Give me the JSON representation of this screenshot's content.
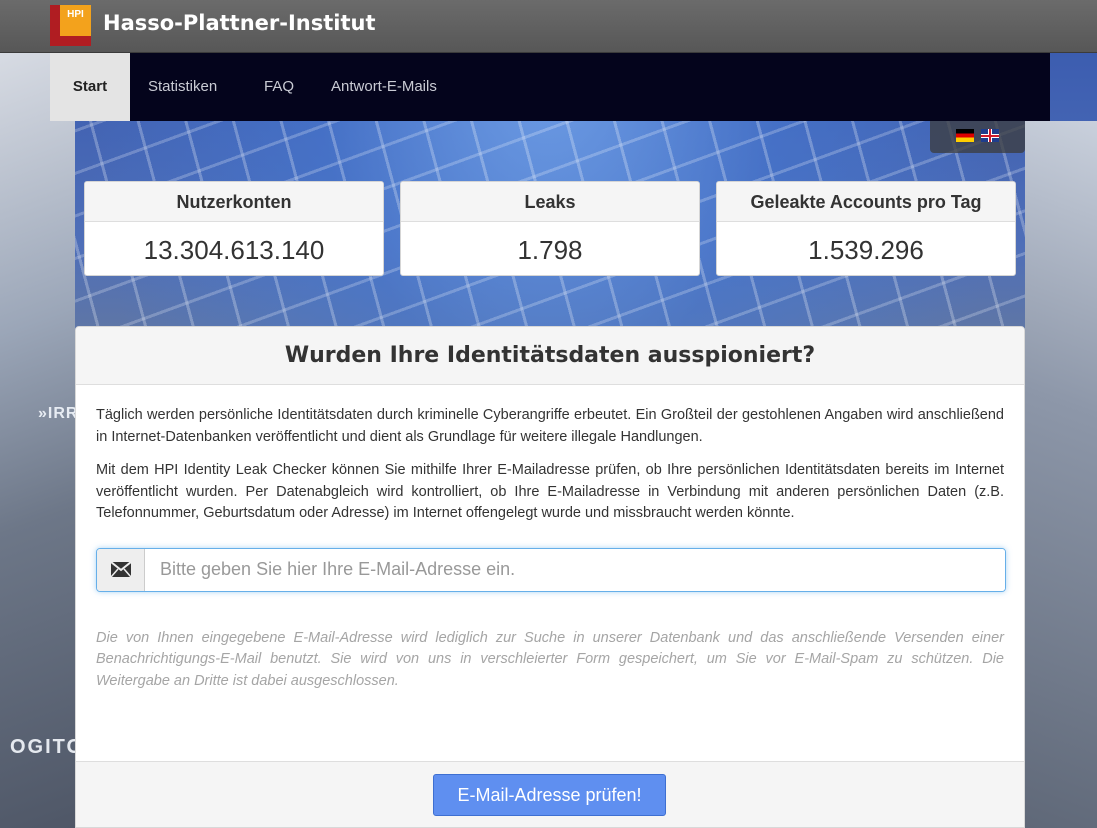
{
  "header": {
    "logo_text": "HPI",
    "title": "Hasso-Plattner-Institut"
  },
  "nav": {
    "items": [
      {
        "label": "Start",
        "active": true
      },
      {
        "label": "Statistiken",
        "active": false
      },
      {
        "label": "FAQ",
        "active": false
      },
      {
        "label": "Antwort-E-Mails",
        "active": false
      }
    ]
  },
  "languages": [
    "de-flag-icon",
    "en-flag-icon"
  ],
  "stats": [
    {
      "label": "Nutzerkonten",
      "value": "13.304.613.140"
    },
    {
      "label": "Leaks",
      "value": "1.798"
    },
    {
      "label": "Geleakte Accounts pro Tag",
      "value": "1.539.296"
    }
  ],
  "background_text": {
    "left_sign_top": "»IRR",
    "left_sign_bottom": "OGITO"
  },
  "panel": {
    "title": "Wurden Ihre Identitätsdaten ausspioniert?",
    "paragraph1": "Täglich werden persönliche Identitätsdaten durch kriminelle Cyberangriffe erbeutet. Ein Großteil der gestohlenen Angaben wird anschließend in Internet-Datenbanken veröffentlicht und dient als Grundlage für weitere illegale Handlungen.",
    "paragraph2": "Mit dem HPI Identity Leak Checker können Sie mithilfe Ihrer E-Mailadresse prüfen, ob Ihre persönlichen Identitätsdaten bereits im Internet veröffentlicht wurden. Per Datenabgleich wird kontrolliert, ob Ihre E-Mailadresse in Verbindung mit anderen persönlichen Daten (z.B. Telefonnummer, Geburtsdatum oder Adresse) im Internet offengelegt wurde und missbraucht werden könnte.",
    "email_placeholder": "Bitte geben Sie hier Ihre E-Mail-Adresse ein.",
    "email_value": "",
    "disclaimer": "Die von Ihnen eingegebene E-Mail-Adresse wird lediglich zur Suche in unserer Datenbank und das anschließende Versenden einer Benachrichtigungs-E-Mail benutzt. Sie wird von uns in verschleierter Form gespeichert, um Sie vor E-Mail-Spam zu schützen. Die Weitergabe an Dritte ist dabei ausgeschlossen.",
    "submit_label": "E-Mail-Adresse prüfen!"
  },
  "colors": {
    "navbar": "#04041c",
    "button": "#5f8ff0",
    "logo_red": "#b01d22",
    "logo_orange": "#f3a21c"
  }
}
